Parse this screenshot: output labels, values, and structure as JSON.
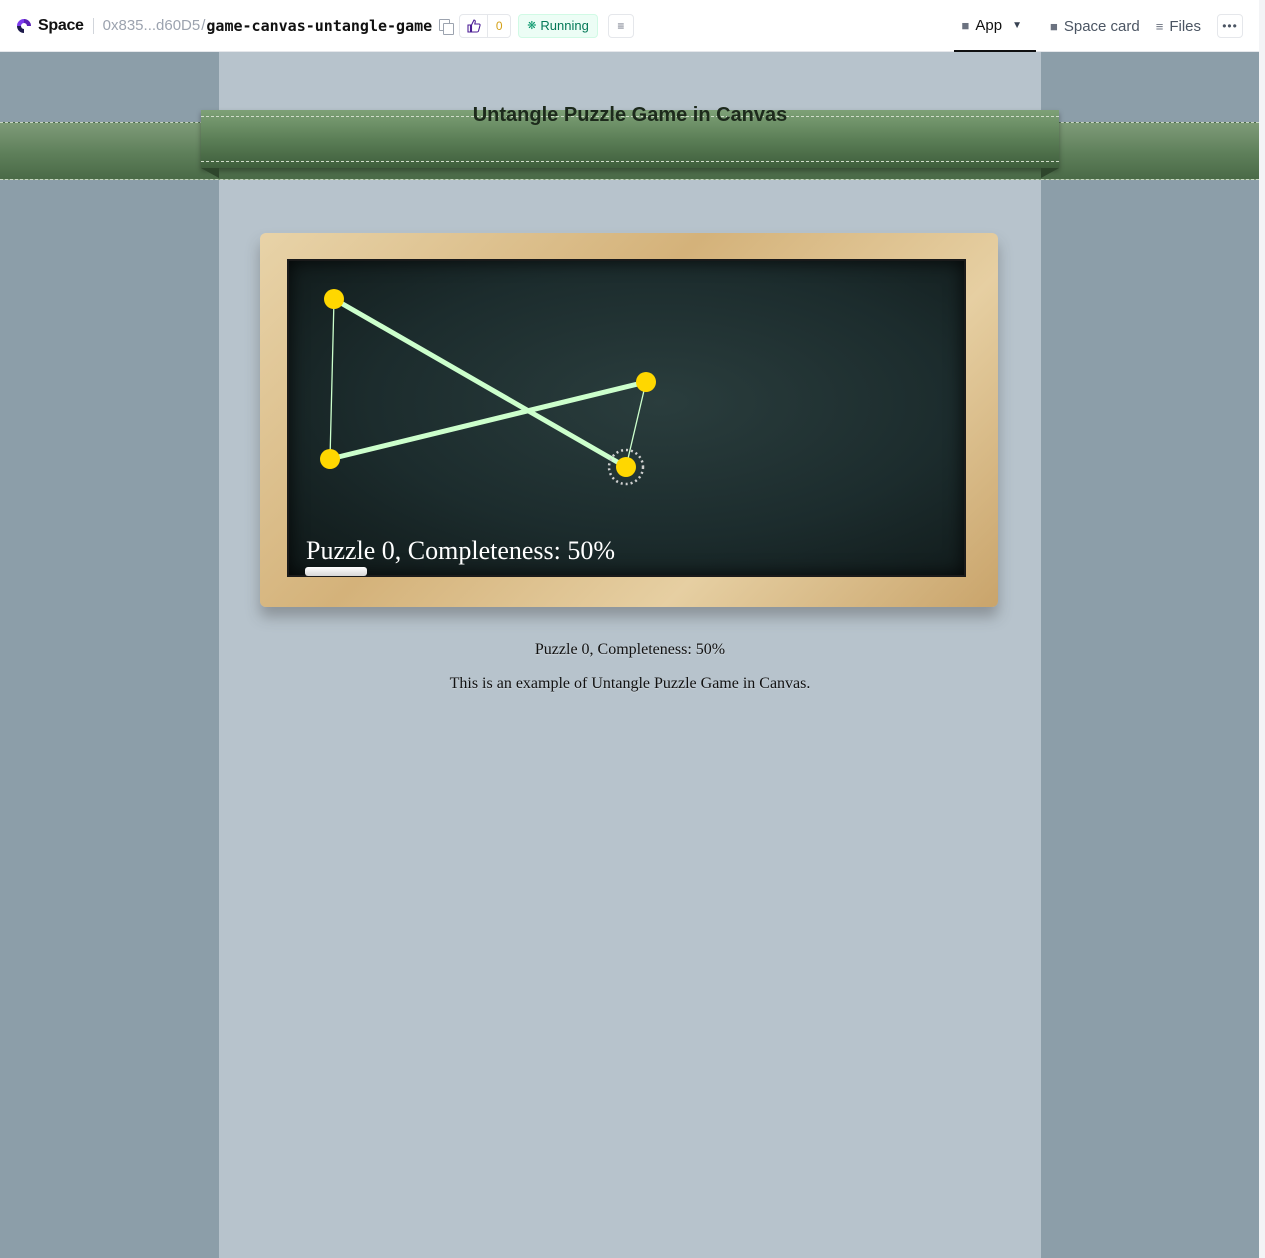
{
  "topbar": {
    "brand": "Space",
    "owner": "0x835...d60D5",
    "separator": "/",
    "repo": "game-canvas-untangle-game",
    "like_count": "0",
    "status": "Running",
    "nav": {
      "app": "App",
      "space_card": "Space card",
      "files": "Files"
    }
  },
  "page": {
    "title": "Untangle Puzzle Game in Canvas",
    "board_status": "Puzzle 0, Completeness: 50%",
    "status_text": "Puzzle 0, Completeness: 50%",
    "description": "This is an example of Untangle Puzzle Game in Canvas."
  },
  "game": {
    "circle_color": "#ffd700",
    "line_color": "#ccffcc",
    "puzzle": 0,
    "completeness_percent": 50,
    "selected_circle": 3
  },
  "colors": {
    "status_green": "#047857",
    "ribbon_green": "#5c7f57",
    "center_background": "#b7c3cc",
    "side_background": "#8c9ea9"
  }
}
